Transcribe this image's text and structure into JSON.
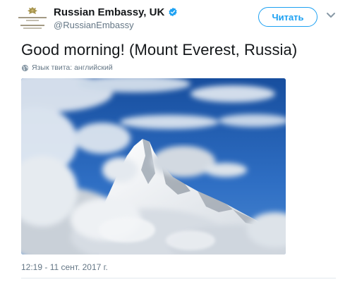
{
  "author": {
    "display_name": "Russian Embassy, UK",
    "handle": "@RussianEmbassy",
    "verified": true,
    "avatar_icon": "embassy-logo"
  },
  "follow_button": {
    "label": "Читать"
  },
  "menu": {
    "icon": "chevron-down-icon"
  },
  "tweet": {
    "text": "Good morning! (Mount Everest, Russia)",
    "language_label": "Язык твита: английский",
    "timestamp": "12:19 - 11 сент. 2017 г."
  },
  "photo": {
    "subject": "snowy-mountain-peak-with-clouds"
  },
  "colors": {
    "accent": "#1da1f2",
    "secondary_text": "#657786",
    "primary_text": "#14171a",
    "sky": "#1f5fb5"
  }
}
